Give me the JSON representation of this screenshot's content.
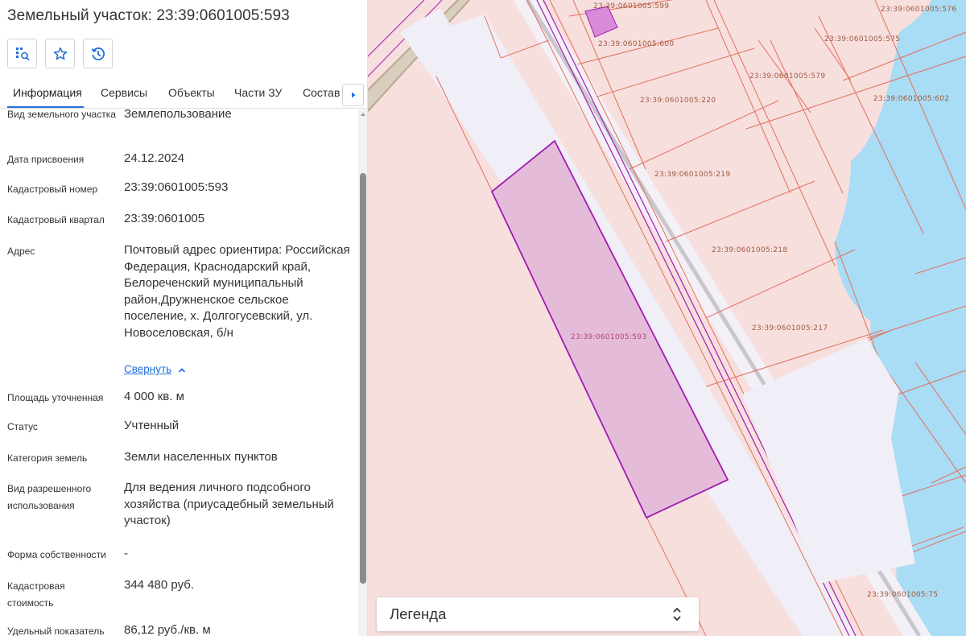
{
  "panel": {
    "title": "Земельный участок: 23:39:0601005:593",
    "toolbar": [
      {
        "icon": "locate-on-map-icon"
      },
      {
        "icon": "star-icon"
      },
      {
        "icon": "history-icon"
      }
    ],
    "tabs": [
      "Информация",
      "Сервисы",
      "Объекты",
      "Части ЗУ",
      "Состав"
    ],
    "active_tab": "Информация"
  },
  "info": {
    "land_type": {
      "label": "Вид земельного участка",
      "value": "Землепользование"
    },
    "assign_date": {
      "label": "Дата присвоения",
      "value": "24.12.2024"
    },
    "cadastral_number": {
      "label": "Кадастровый номер",
      "value": "23:39:0601005:593"
    },
    "cadastral_quarter": {
      "label": "Кадастровый квартал",
      "value": "23:39:0601005"
    },
    "address": {
      "label": "Адрес",
      "value": "Почтовый адрес ориентира: Российская Федерация, Краснодарский край, Белореченский муниципальный район,Дружненское сельское поселение, х. Долгогусевский, ул. Новоселовская, б/н",
      "collapse_label": "Свернуть"
    },
    "area": {
      "label": "Площадь уточненная",
      "value": "4 000 кв. м"
    },
    "status": {
      "label": "Статус",
      "value": "Учтенный"
    },
    "category": {
      "label": "Категория земель",
      "value": "Земли населенных пунктов"
    },
    "permitted_use": {
      "label": "Вид разрешенного использования",
      "value": "Для ведения личного подсобного хозяйства (приусадебный земельный участок)"
    },
    "ownership": {
      "label": "Форма собственности",
      "value": "-"
    },
    "cadastral_value": {
      "label": "Кадастровая стоимость",
      "value": "344 480 руб."
    },
    "unit_value": {
      "label": "Удельный показатель",
      "value": "86,12 руб./кв. м"
    }
  },
  "map": {
    "parcel_labels": [
      "23:39:0601005:599",
      "23:39:0601005:576",
      "23:39:0601005:600",
      "23:39:0601005:575",
      "23:39:0601005:579",
      "23:39:0601005:220",
      "23:39:0601005:602",
      "23:39:0601005:219",
      "23:39:0601005:218",
      "23:39:0601005:217",
      "23:39:0601005:593",
      "23:39:0601005:75"
    ],
    "colors": {
      "parcel_fill": "#f7dfde",
      "parcel_border": "#e46f5a",
      "selected_fill": "#e4bcd9",
      "selected_border": "#a11bb2",
      "water": "#a9dcf5",
      "road": "#f0eef6"
    }
  },
  "legend": {
    "label": "Легенда"
  }
}
